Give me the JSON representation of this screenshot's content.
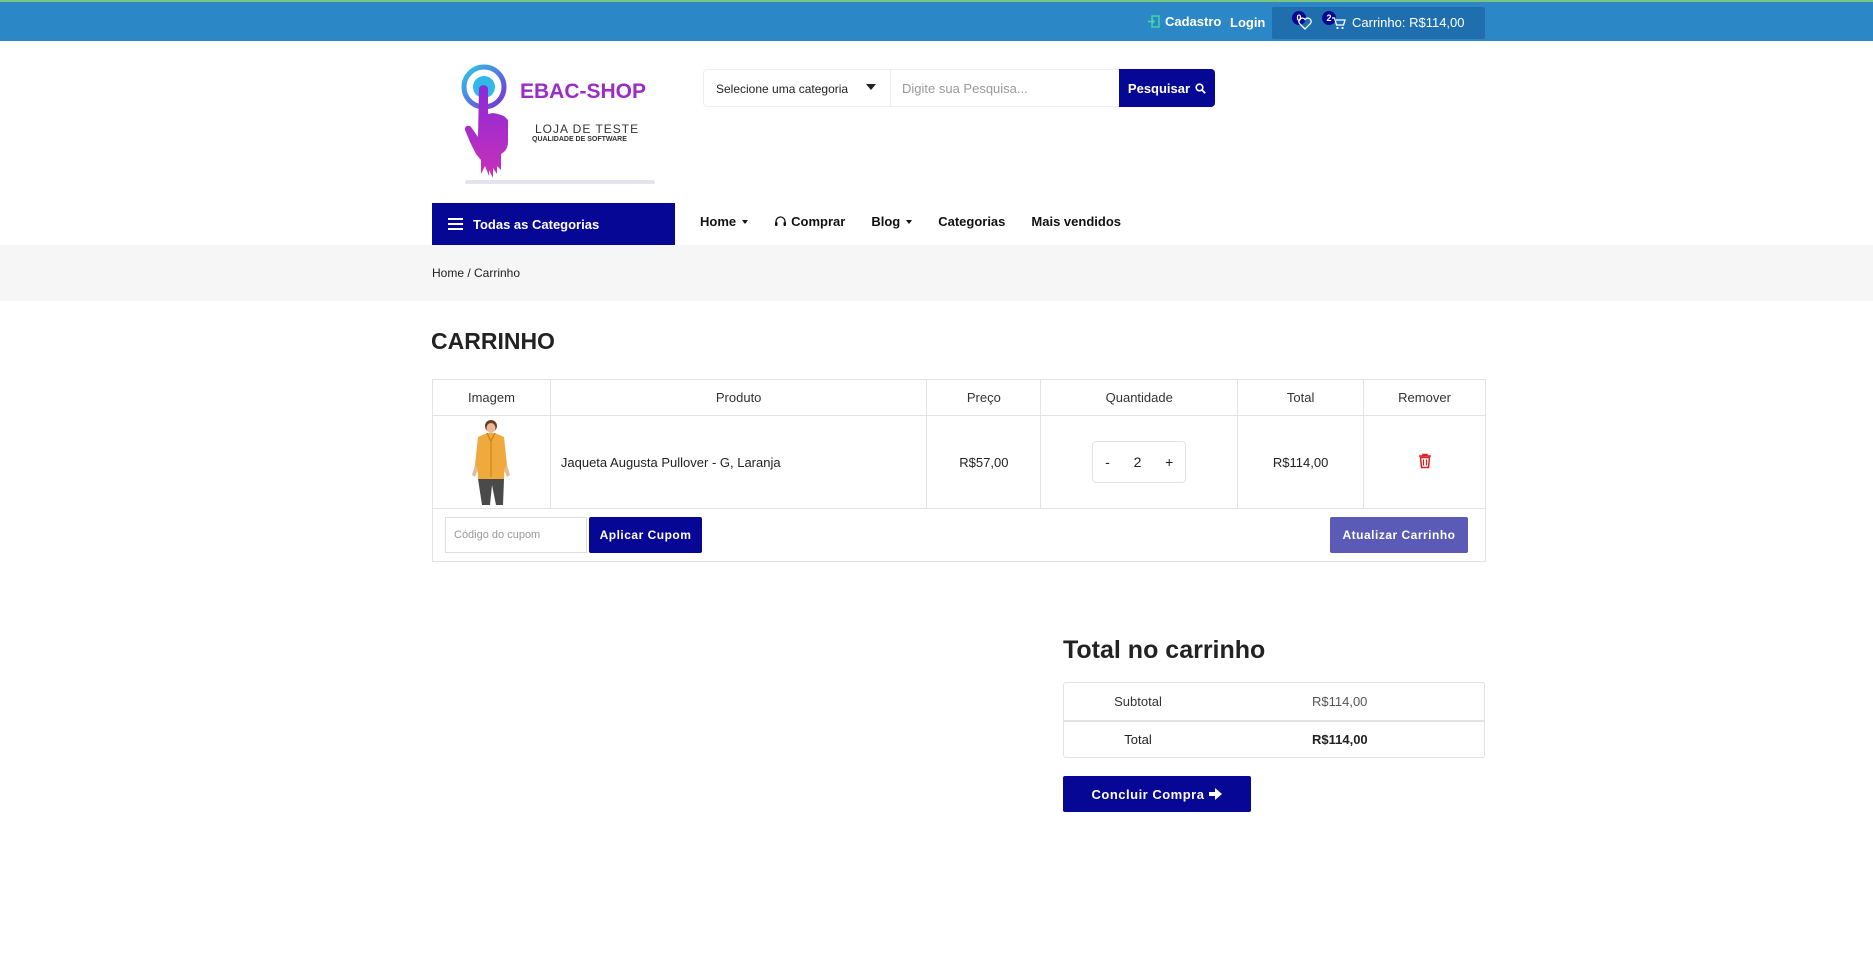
{
  "topbar": {
    "register": "Cadastro",
    "login": "Login",
    "wishlist_count": "0",
    "cart_count": "2",
    "cart_label": "Carrinho: R$114,00"
  },
  "logo": {
    "title": "EBAC-SHOP",
    "subtitle": "LOJA DE TESTE",
    "tagline": "QUALIDADE DE SOFTWARE"
  },
  "search": {
    "category": "Selecione uma categoria",
    "placeholder": "Digite sua Pesquisa...",
    "button": "Pesquisar"
  },
  "nav": {
    "all_categories": "Todas as Categorias",
    "items": [
      "Home",
      "Comprar",
      "Blog",
      "Categorias",
      "Mais vendidos"
    ]
  },
  "breadcrumb": "Home / Carrinho",
  "page_title": "CARRINHO",
  "cart_table": {
    "headers": [
      "Imagem",
      "Produto",
      "Preço",
      "Quantidade",
      "Total",
      "Remover"
    ],
    "rows": [
      {
        "product": "Jaqueta Augusta Pullover - G, Laranja",
        "price": "R$57,00",
        "qty": "2",
        "total": "R$114,00"
      }
    ]
  },
  "coupon": {
    "placeholder": "Código do cupom",
    "apply": "Aplicar Cupom",
    "update": "Atualizar Carrinho"
  },
  "totals": {
    "title": "Total no carrinho",
    "subtotal_label": "Subtotal",
    "subtotal": "R$114,00",
    "total_label": "Total",
    "total": "R$114,00",
    "checkout": "Concluir Compra"
  },
  "colors": {
    "topbar": "#2b87c5",
    "primary": "#070795",
    "update_btn": "#5b5bb7",
    "remove": "#e02020"
  }
}
